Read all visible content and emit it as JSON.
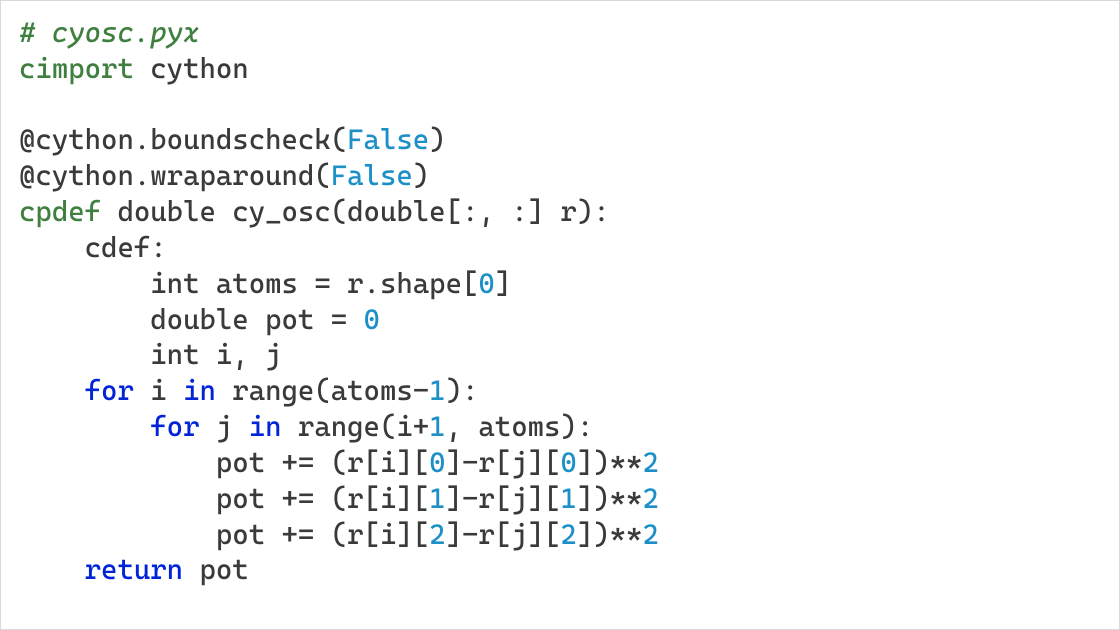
{
  "code": {
    "lines": [
      {
        "indent": 0,
        "tokens": [
          {
            "t": "# cyosc.pyx",
            "c": "comment"
          }
        ]
      },
      {
        "indent": 0,
        "tokens": [
          {
            "t": "cimport",
            "c": "keyword"
          },
          {
            "t": " cython",
            "c": "ident"
          }
        ]
      },
      {
        "indent": 0,
        "tokens": []
      },
      {
        "indent": 0,
        "tokens": [
          {
            "t": "@cython",
            "c": "decorator"
          },
          {
            "t": ".",
            "c": "punct"
          },
          {
            "t": "boundscheck",
            "c": "ident"
          },
          {
            "t": "(",
            "c": "punct"
          },
          {
            "t": "False",
            "c": "constant"
          },
          {
            "t": ")",
            "c": "punct"
          }
        ]
      },
      {
        "indent": 0,
        "tokens": [
          {
            "t": "@cython",
            "c": "decorator"
          },
          {
            "t": ".",
            "c": "punct"
          },
          {
            "t": "wraparound",
            "c": "ident"
          },
          {
            "t": "(",
            "c": "punct"
          },
          {
            "t": "False",
            "c": "constant"
          },
          {
            "t": ")",
            "c": "punct"
          }
        ]
      },
      {
        "indent": 0,
        "tokens": [
          {
            "t": "cpdef",
            "c": "keyword"
          },
          {
            "t": " double cy_osc(double[:, :] r):",
            "c": "ident"
          }
        ]
      },
      {
        "indent": 4,
        "tokens": [
          {
            "t": "cdef:",
            "c": "ident"
          }
        ]
      },
      {
        "indent": 8,
        "tokens": [
          {
            "t": "int atoms ",
            "c": "ident"
          },
          {
            "t": "= ",
            "c": "operator"
          },
          {
            "t": "r",
            "c": "ident"
          },
          {
            "t": ".",
            "c": "punct"
          },
          {
            "t": "shape[",
            "c": "ident"
          },
          {
            "t": "0",
            "c": "number"
          },
          {
            "t": "]",
            "c": "punct"
          }
        ]
      },
      {
        "indent": 8,
        "tokens": [
          {
            "t": "double pot ",
            "c": "ident"
          },
          {
            "t": "= ",
            "c": "operator"
          },
          {
            "t": "0",
            "c": "number"
          }
        ]
      },
      {
        "indent": 8,
        "tokens": [
          {
            "t": "int i, j",
            "c": "ident"
          }
        ]
      },
      {
        "indent": 4,
        "tokens": [
          {
            "t": "for",
            "c": "control"
          },
          {
            "t": " i ",
            "c": "ident"
          },
          {
            "t": "in",
            "c": "control"
          },
          {
            "t": " range(atoms",
            "c": "ident"
          },
          {
            "t": "-",
            "c": "operator"
          },
          {
            "t": "1",
            "c": "number"
          },
          {
            "t": "):",
            "c": "punct"
          }
        ]
      },
      {
        "indent": 8,
        "tokens": [
          {
            "t": "for",
            "c": "control"
          },
          {
            "t": " j ",
            "c": "ident"
          },
          {
            "t": "in",
            "c": "control"
          },
          {
            "t": " range(i",
            "c": "ident"
          },
          {
            "t": "+",
            "c": "operator"
          },
          {
            "t": "1",
            "c": "number"
          },
          {
            "t": ", atoms):",
            "c": "ident"
          }
        ]
      },
      {
        "indent": 12,
        "tokens": [
          {
            "t": "pot ",
            "c": "ident"
          },
          {
            "t": "+=",
            "c": "operator"
          },
          {
            "t": " (r[i][",
            "c": "ident"
          },
          {
            "t": "0",
            "c": "number"
          },
          {
            "t": "]",
            "c": "punct"
          },
          {
            "t": "-",
            "c": "operator"
          },
          {
            "t": "r[j][",
            "c": "ident"
          },
          {
            "t": "0",
            "c": "number"
          },
          {
            "t": "])",
            "c": "punct"
          },
          {
            "t": "**",
            "c": "operator"
          },
          {
            "t": "2",
            "c": "number"
          }
        ]
      },
      {
        "indent": 12,
        "tokens": [
          {
            "t": "pot ",
            "c": "ident"
          },
          {
            "t": "+=",
            "c": "operator"
          },
          {
            "t": " (r[i][",
            "c": "ident"
          },
          {
            "t": "1",
            "c": "number"
          },
          {
            "t": "]",
            "c": "punct"
          },
          {
            "t": "-",
            "c": "operator"
          },
          {
            "t": "r[j][",
            "c": "ident"
          },
          {
            "t": "1",
            "c": "number"
          },
          {
            "t": "])",
            "c": "punct"
          },
          {
            "t": "**",
            "c": "operator"
          },
          {
            "t": "2",
            "c": "number"
          }
        ]
      },
      {
        "indent": 12,
        "tokens": [
          {
            "t": "pot ",
            "c": "ident"
          },
          {
            "t": "+=",
            "c": "operator"
          },
          {
            "t": " (r[i][",
            "c": "ident"
          },
          {
            "t": "2",
            "c": "number"
          },
          {
            "t": "]",
            "c": "punct"
          },
          {
            "t": "-",
            "c": "operator"
          },
          {
            "t": "r[j][",
            "c": "ident"
          },
          {
            "t": "2",
            "c": "number"
          },
          {
            "t": "])",
            "c": "punct"
          },
          {
            "t": "**",
            "c": "operator"
          },
          {
            "t": "2",
            "c": "number"
          }
        ]
      },
      {
        "indent": 4,
        "tokens": [
          {
            "t": "return",
            "c": "control"
          },
          {
            "t": " pot",
            "c": "ident"
          }
        ]
      }
    ]
  }
}
